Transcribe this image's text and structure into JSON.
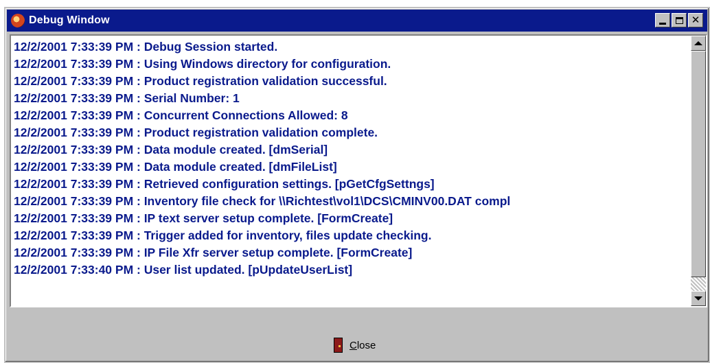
{
  "window": {
    "title": "Debug Window",
    "title_buttons": [
      "minimize-icon",
      "maximize-icon",
      "close-icon"
    ]
  },
  "log": {
    "lines": [
      "12/2/2001 7:33:39 PM : Debug Session started.",
      "12/2/2001 7:33:39 PM : Using Windows directory for configuration.",
      "12/2/2001 7:33:39 PM : Product registration validation successful.",
      "12/2/2001 7:33:39 PM : Serial Number: 1",
      "12/2/2001 7:33:39 PM : Concurrent Connections Allowed: 8",
      "12/2/2001 7:33:39 PM : Product registration validation complete.",
      "12/2/2001 7:33:39 PM : Data module created. [dmSerial]",
      "12/2/2001 7:33:39 PM : Data module created. [dmFileList]",
      "12/2/2001 7:33:39 PM : Retrieved configuration settings. [pGetCfgSettngs]",
      "12/2/2001 7:33:39 PM : Inventory file check for \\\\Richtest\\vol1\\DCS\\CMINV00.DAT compl",
      "12/2/2001 7:33:39 PM : IP text server setup complete. [FormCreate]",
      "12/2/2001 7:33:39 PM : Trigger added for inventory, files update checking.",
      "12/2/2001 7:33:39 PM : IP File Xfr server setup complete. [FormCreate]",
      "12/2/2001 7:33:40 PM : User list updated. [pUpdateUserList]"
    ]
  },
  "footer": {
    "close_label_accel": "C",
    "close_label_rest": "lose",
    "close_icon": "door-icon"
  },
  "colors": {
    "titlebar": "#0a1a8c",
    "log_text": "#0a1a8c",
    "face": "#c0c0c0"
  }
}
